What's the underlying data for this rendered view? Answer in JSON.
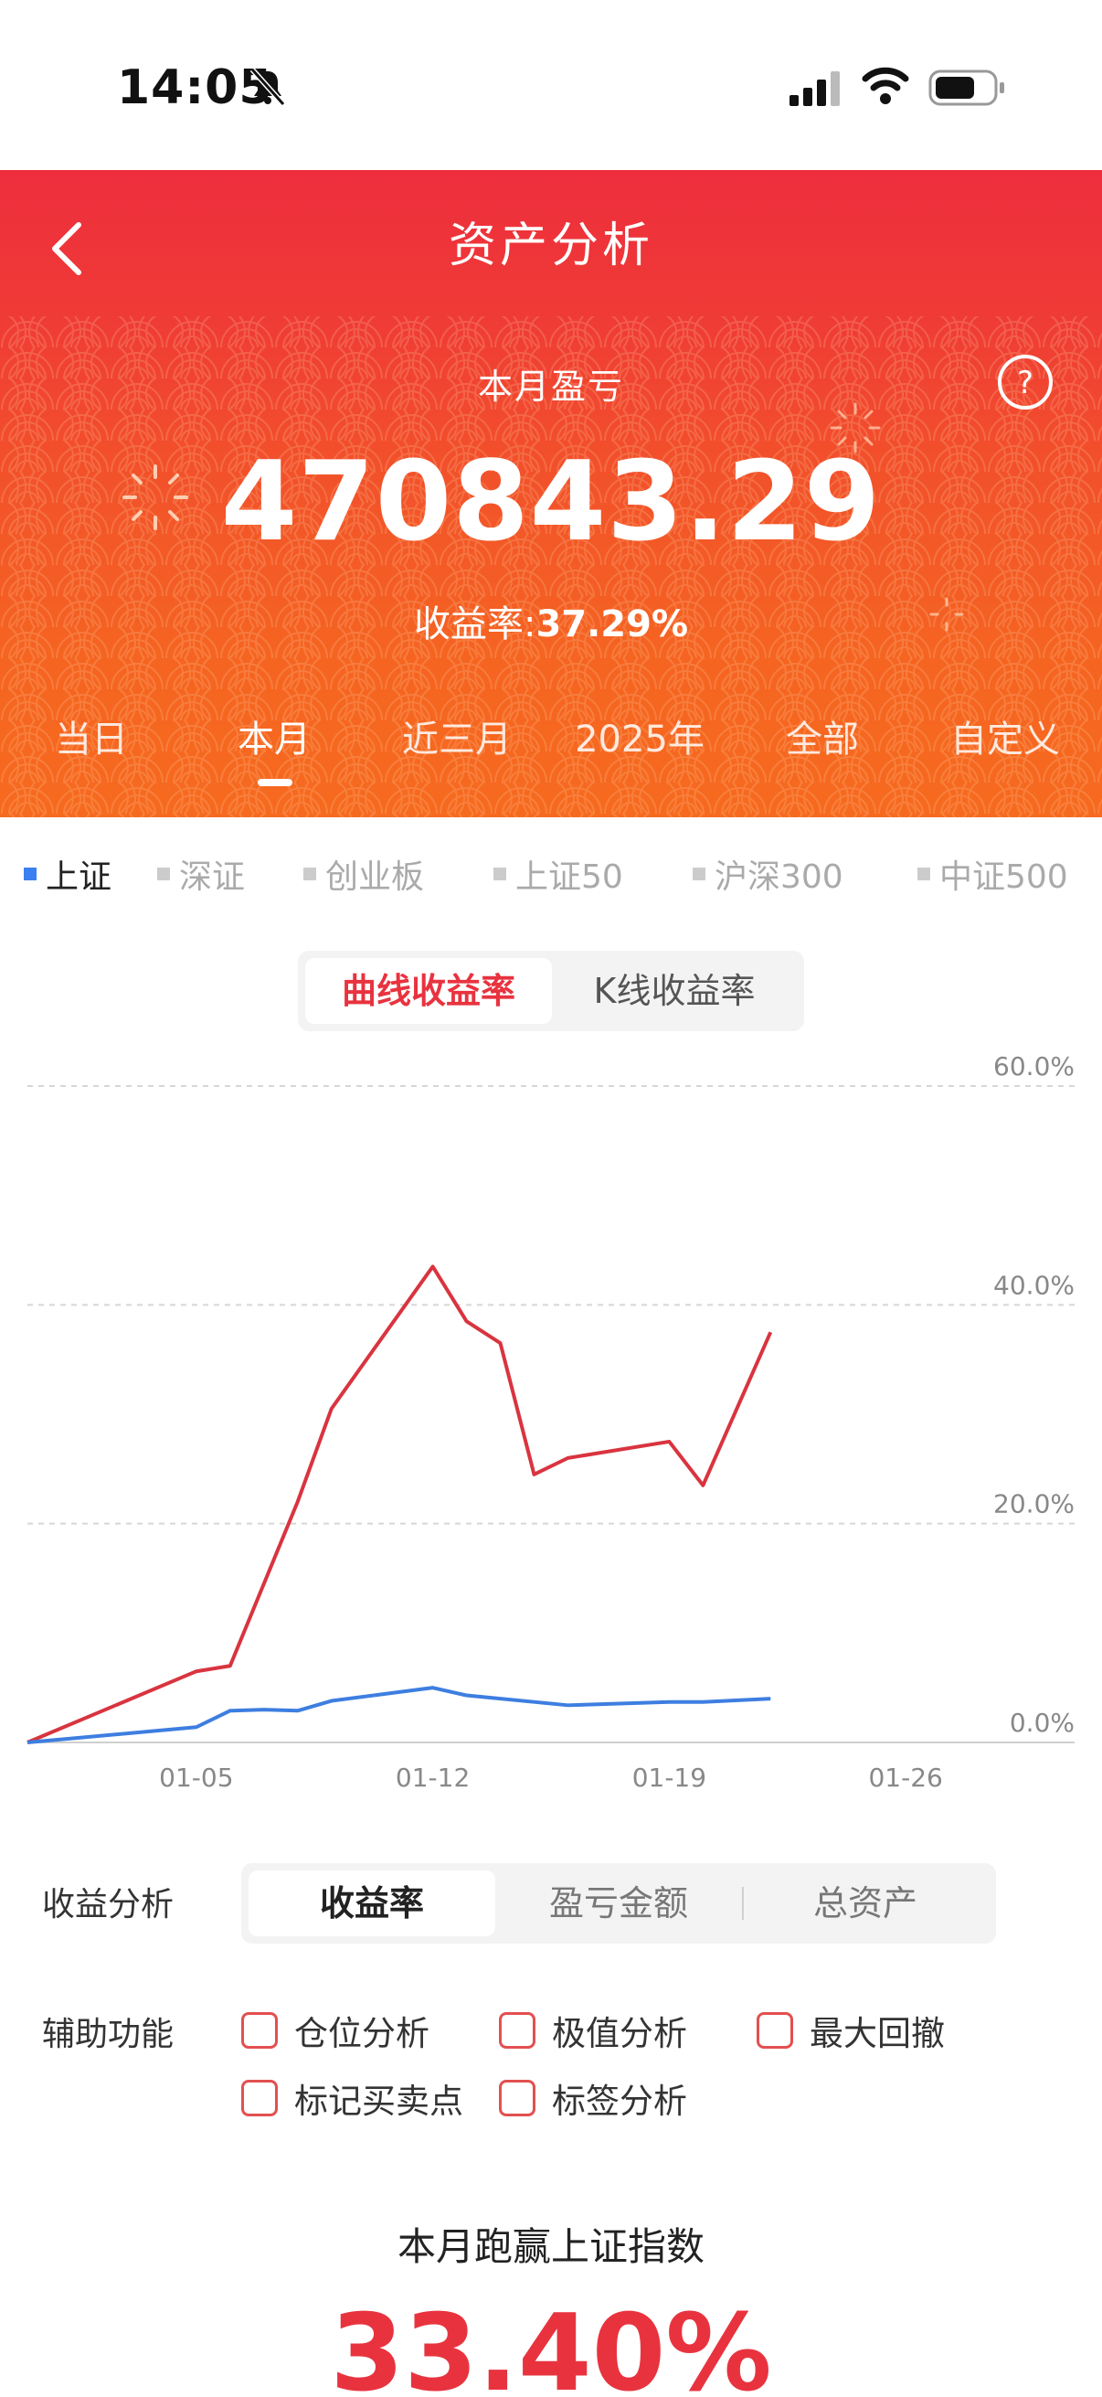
{
  "status": {
    "time": "14:05"
  },
  "header": {
    "title": "资产分析",
    "month_label": "本月盈亏",
    "amount": "470843.29",
    "rate_label": "收益率:",
    "rate_value": "37.29%",
    "periods": [
      "当日",
      "本月",
      "近三月",
      "2025年",
      "全部",
      "自定义"
    ],
    "active_period": "本月"
  },
  "indices": [
    "上证",
    "深证",
    "创业板",
    "上证50",
    "沪深300",
    "中证500"
  ],
  "active_index": "上证",
  "chart_mode": {
    "active": "曲线收益率",
    "other": "K线收益率"
  },
  "chart_data": {
    "type": "line",
    "y_ticks": [
      "60.0%",
      "40.0%",
      "20.0%",
      "0.0%"
    ],
    "x_ticks": [
      "01-05",
      "01-12",
      "01-19",
      "01-26"
    ],
    "ylim": [
      0,
      60
    ],
    "x_range": [
      0,
      31
    ],
    "series": [
      {
        "color": "#d9343f",
        "points": [
          [
            0,
            0
          ],
          [
            5,
            6.5
          ],
          [
            6,
            7
          ],
          [
            8,
            22
          ],
          [
            9,
            30.5
          ],
          [
            12,
            43.5
          ],
          [
            13,
            38.5
          ],
          [
            14,
            36.5
          ],
          [
            15,
            24.5
          ],
          [
            16,
            26
          ],
          [
            19,
            27.5
          ],
          [
            20,
            23.5
          ],
          [
            22,
            37.5
          ]
        ]
      },
      {
        "color": "#3d7ee0",
        "points": [
          [
            0,
            0
          ],
          [
            5,
            1.4
          ],
          [
            6,
            2.9
          ],
          [
            7,
            3.0
          ],
          [
            8,
            2.9
          ],
          [
            9,
            3.8
          ],
          [
            12,
            5.0
          ],
          [
            13,
            4.3
          ],
          [
            16,
            3.4
          ],
          [
            19,
            3.7
          ],
          [
            20,
            3.7
          ],
          [
            22,
            4.0
          ]
        ]
      }
    ]
  },
  "analysis": {
    "label": "收益分析",
    "options": [
      "收益率",
      "盈亏金额",
      "总资产"
    ],
    "active": "收益率"
  },
  "aux": {
    "label": "辅助功能",
    "options": [
      "仓位分析",
      "极值分析",
      "最大回撤",
      "标记买卖点",
      "标签分析"
    ]
  },
  "beat": {
    "title": "本月跑赢上证指数",
    "value": "33.40%"
  },
  "colors": {
    "brand_red": "#ee2e3d",
    "accent_orange": "#f66a1f",
    "index_blue": "#3c7ff0"
  }
}
